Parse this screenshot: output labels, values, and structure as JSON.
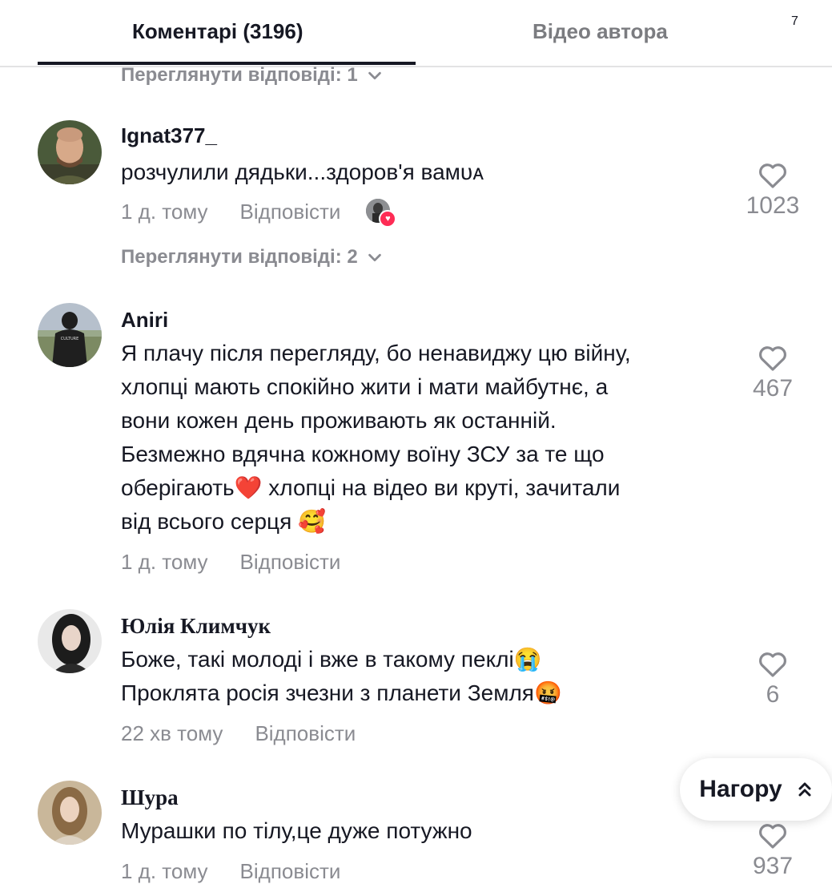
{
  "tabs": {
    "comments": "Коментарі (3196)",
    "author_videos": "Відео автора",
    "corner_mark": "7"
  },
  "top_view_replies": "Переглянути відповіді: 1",
  "comments": [
    {
      "username": "Ignat377_",
      "text": "розчулили дядьки...здоров'я вамᴜᴀ",
      "time": "1 д. тому",
      "reply": "Відповісти",
      "likes": "1023",
      "view_replies": "Переглянути відповіді: 2"
    },
    {
      "username": "Aniri",
      "lines": [
        "Я плачу після перегляду, бо ненавиджу цю війну,",
        "хлопці мають спокійно жити і мати майбутнє, а",
        "вони кожен день проживають як останній.",
        "Безмежно вдячна кожному воїну ЗСУ за те що",
        "оберігають",
        " хлопці на відео ви круті, зачитали",
        "від всього серця "
      ],
      "time": "1 д. тому",
      "reply": "Відповісти",
      "likes": "467"
    },
    {
      "username": "Юлія Климчук",
      "lines": [
        "Боже, такі молоді і вже в такому пеклі",
        "Проклята росія зчезни з планети Земля"
      ],
      "time": "22 хв тому",
      "reply": "Відповісти",
      "likes": "6"
    },
    {
      "username": "Шура",
      "text": "Мурашки по тілу,це дуже потужно",
      "time": "1 д. тому",
      "reply": "Відповісти",
      "likes": "937"
    }
  ],
  "emojis": {
    "heart": "❤️",
    "smiling_hearts": "🥰",
    "crying": "😭",
    "cursing": "🤬"
  },
  "to_top": "Нагору",
  "colors": {
    "text": "#161823",
    "muted": "#8a8b91",
    "brand_red": "#fe2c55",
    "divider": "#e3e3e4"
  }
}
